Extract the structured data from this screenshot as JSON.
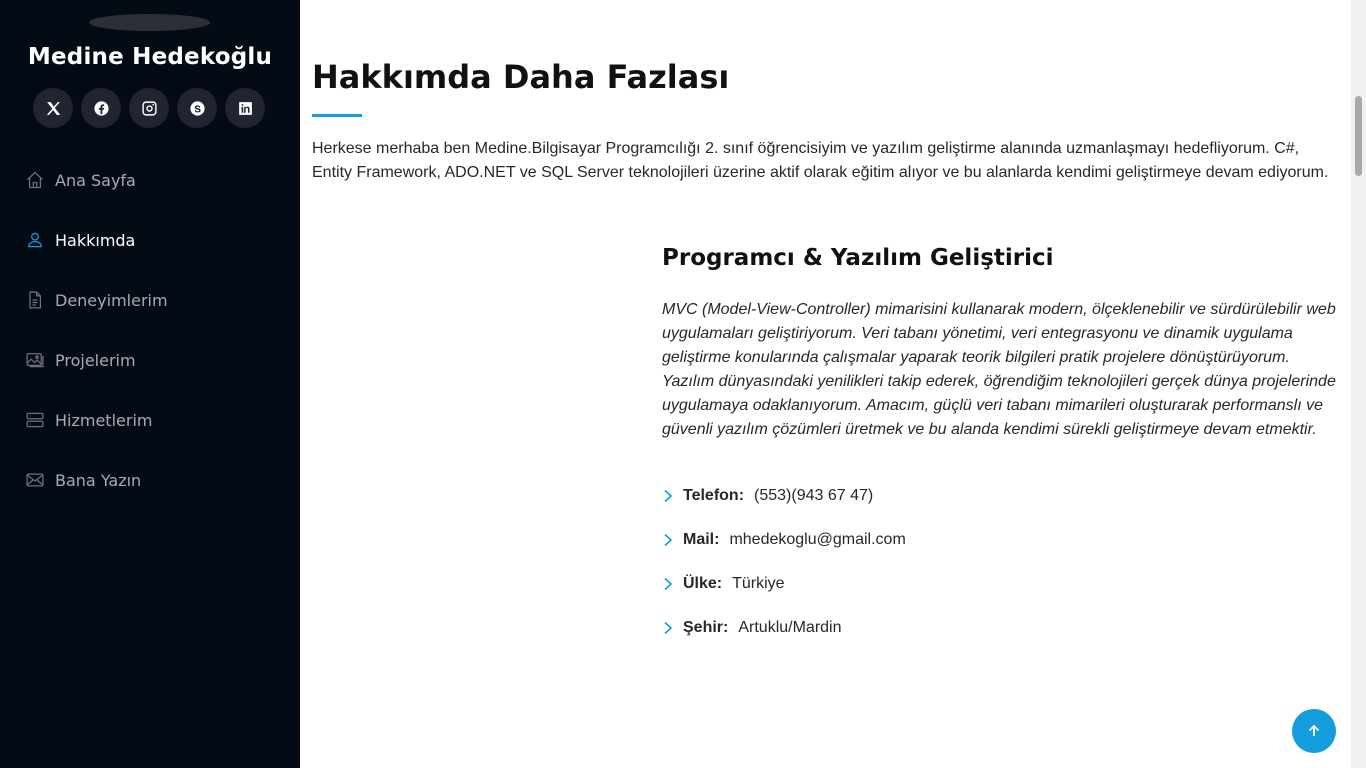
{
  "profile": {
    "name": "Medine Hedekoğlu"
  },
  "social": [
    {
      "icon": "x-icon"
    },
    {
      "icon": "facebook-icon"
    },
    {
      "icon": "instagram-icon"
    },
    {
      "icon": "skype-icon"
    },
    {
      "icon": "linkedin-icon"
    }
  ],
  "nav": [
    {
      "label": "Ana Sayfa",
      "icon": "home-icon",
      "active": false
    },
    {
      "label": "Hakkımda",
      "icon": "person-icon",
      "active": true
    },
    {
      "label": "Deneyimlerim",
      "icon": "file-icon",
      "active": false
    },
    {
      "label": "Projelerim",
      "icon": "images-icon",
      "active": false
    },
    {
      "label": "Hizmetlerim",
      "icon": "server-icon",
      "active": false
    },
    {
      "label": "Bana Yazın",
      "icon": "envelope-icon",
      "active": false
    }
  ],
  "main": {
    "title": "Hakkımda Daha Fazlası",
    "intro": "Herkese merhaba ben Medine.Bilgisayar Programcılığı 2. sınıf öğrencisiyim ve yazılım geliştirme alanında uzmanlaşmayı hedefliyorum. C#, Entity Framework, ADO.NET ve SQL Server teknolojileri üzerine aktif olarak eğitim alıyor ve bu alanlarda kendimi geliştirmeye devam ediyorum.",
    "subtitle": "Programcı & Yazılım Geliştirici",
    "description": "MVC (Model-View-Controller) mimarisini kullanarak modern, ölçeklenebilir ve sürdürülebilir web uygulamaları geliştiriyorum. Veri tabanı yönetimi, veri entegrasyonu ve dinamik uygulama geliştirme konularında çalışmalar yaparak teorik bilgileri pratik projelere dönüştürüyorum. Yazılım dünyasındaki yenilikleri takip ederek, öğrendiğim teknolojileri gerçek dünya projelerinde uygulamaya odaklanıyorum. Amacım, güçlü veri tabanı mimarileri oluşturarak performanslı ve güvenli yazılım çözümleri üretmek ve bu alanda kendimi sürekli geliştirmeye devam etmektir.",
    "info": [
      {
        "label": "Telefon:",
        "value": "(553)(943 67 47)"
      },
      {
        "label": "Mail:",
        "value": "mhedekoglu@gmail.com"
      },
      {
        "label": "Ülke:",
        "value": "Türkiye"
      },
      {
        "label": "Şehir:",
        "value": "Artuklu/Mardin"
      }
    ]
  },
  "colors": {
    "accent": "#149ddd",
    "sidebar_bg": "#040b14",
    "social_bg": "#212431"
  }
}
